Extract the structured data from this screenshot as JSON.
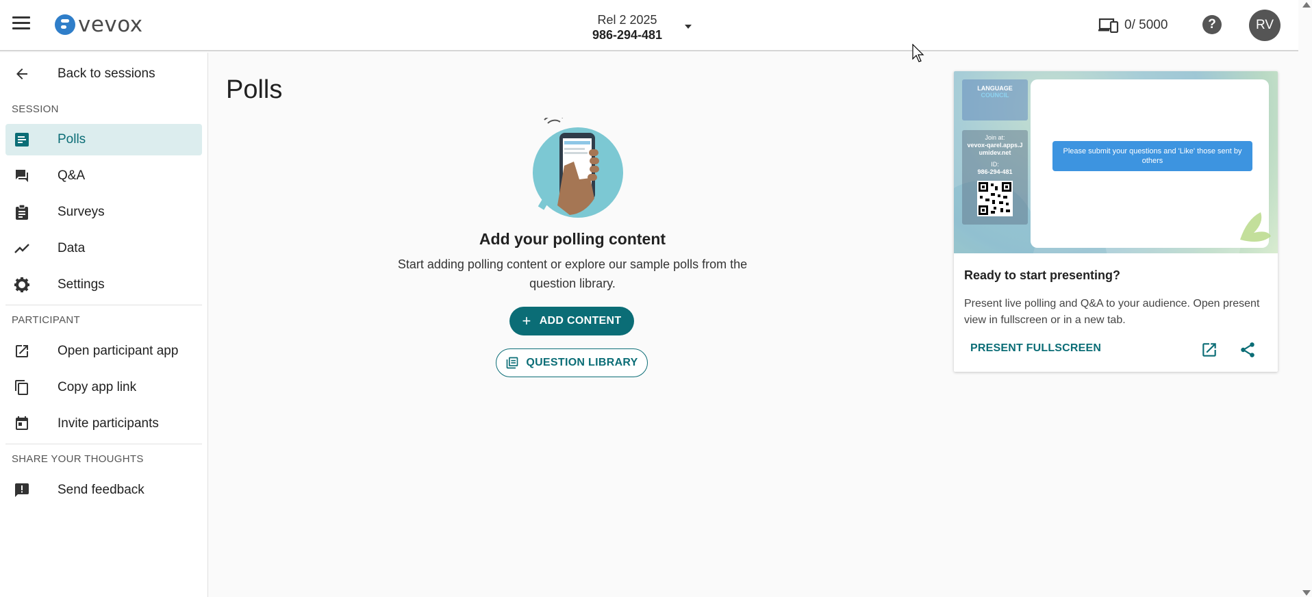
{
  "header": {
    "logo_text": "vevox",
    "session_name": "Rel 2 2025",
    "session_code": "986-294-481",
    "device_count": "0/ 5000",
    "help_label": "?",
    "avatar_initials": "RV"
  },
  "sidebar": {
    "back_label": "Back to sessions",
    "session_heading": "SESSION",
    "session_items": [
      {
        "label": "Polls",
        "icon": "polls-icon"
      },
      {
        "label": "Q&A",
        "icon": "qa-icon"
      },
      {
        "label": "Surveys",
        "icon": "surveys-icon"
      },
      {
        "label": "Data",
        "icon": "data-icon"
      },
      {
        "label": "Settings",
        "icon": "gear-icon"
      }
    ],
    "participant_heading": "PARTICIPANT",
    "participant_items": [
      {
        "label": "Open participant app",
        "icon": "open-external-icon"
      },
      {
        "label": "Copy app link",
        "icon": "copy-icon"
      },
      {
        "label": "Invite participants",
        "icon": "calendar-icon"
      }
    ],
    "thoughts_heading": "SHARE YOUR THOUGHTS",
    "feedback_label": "Send feedback"
  },
  "main": {
    "title": "Polls",
    "empty_title": "Add your polling content",
    "empty_desc": "Start adding polling content or explore our sample polls from the question library.",
    "add_content_label": "ADD CONTENT",
    "question_library_label": "QUESTION LIBRARY"
  },
  "present_card": {
    "preview": {
      "brand_line1": "LANGUAGE",
      "brand_line2": "COUNCIL",
      "join_label": "Join at:",
      "join_url": "vevox-qarel.apps.Jumidev.net",
      "id_label": "ID:",
      "id_value": "986-294-481",
      "message": "Please submit your questions and 'Like' those sent by others"
    },
    "title": "Ready to start presenting?",
    "description": "Present live polling and Q&A to your audience. Open present view in fullscreen or in a new tab.",
    "fullscreen_label": "PRESENT FULLSCREEN"
  },
  "colors": {
    "accent": "#0b6d76",
    "active_bg": "#dcedee",
    "preview_msg": "#3d94e0"
  }
}
